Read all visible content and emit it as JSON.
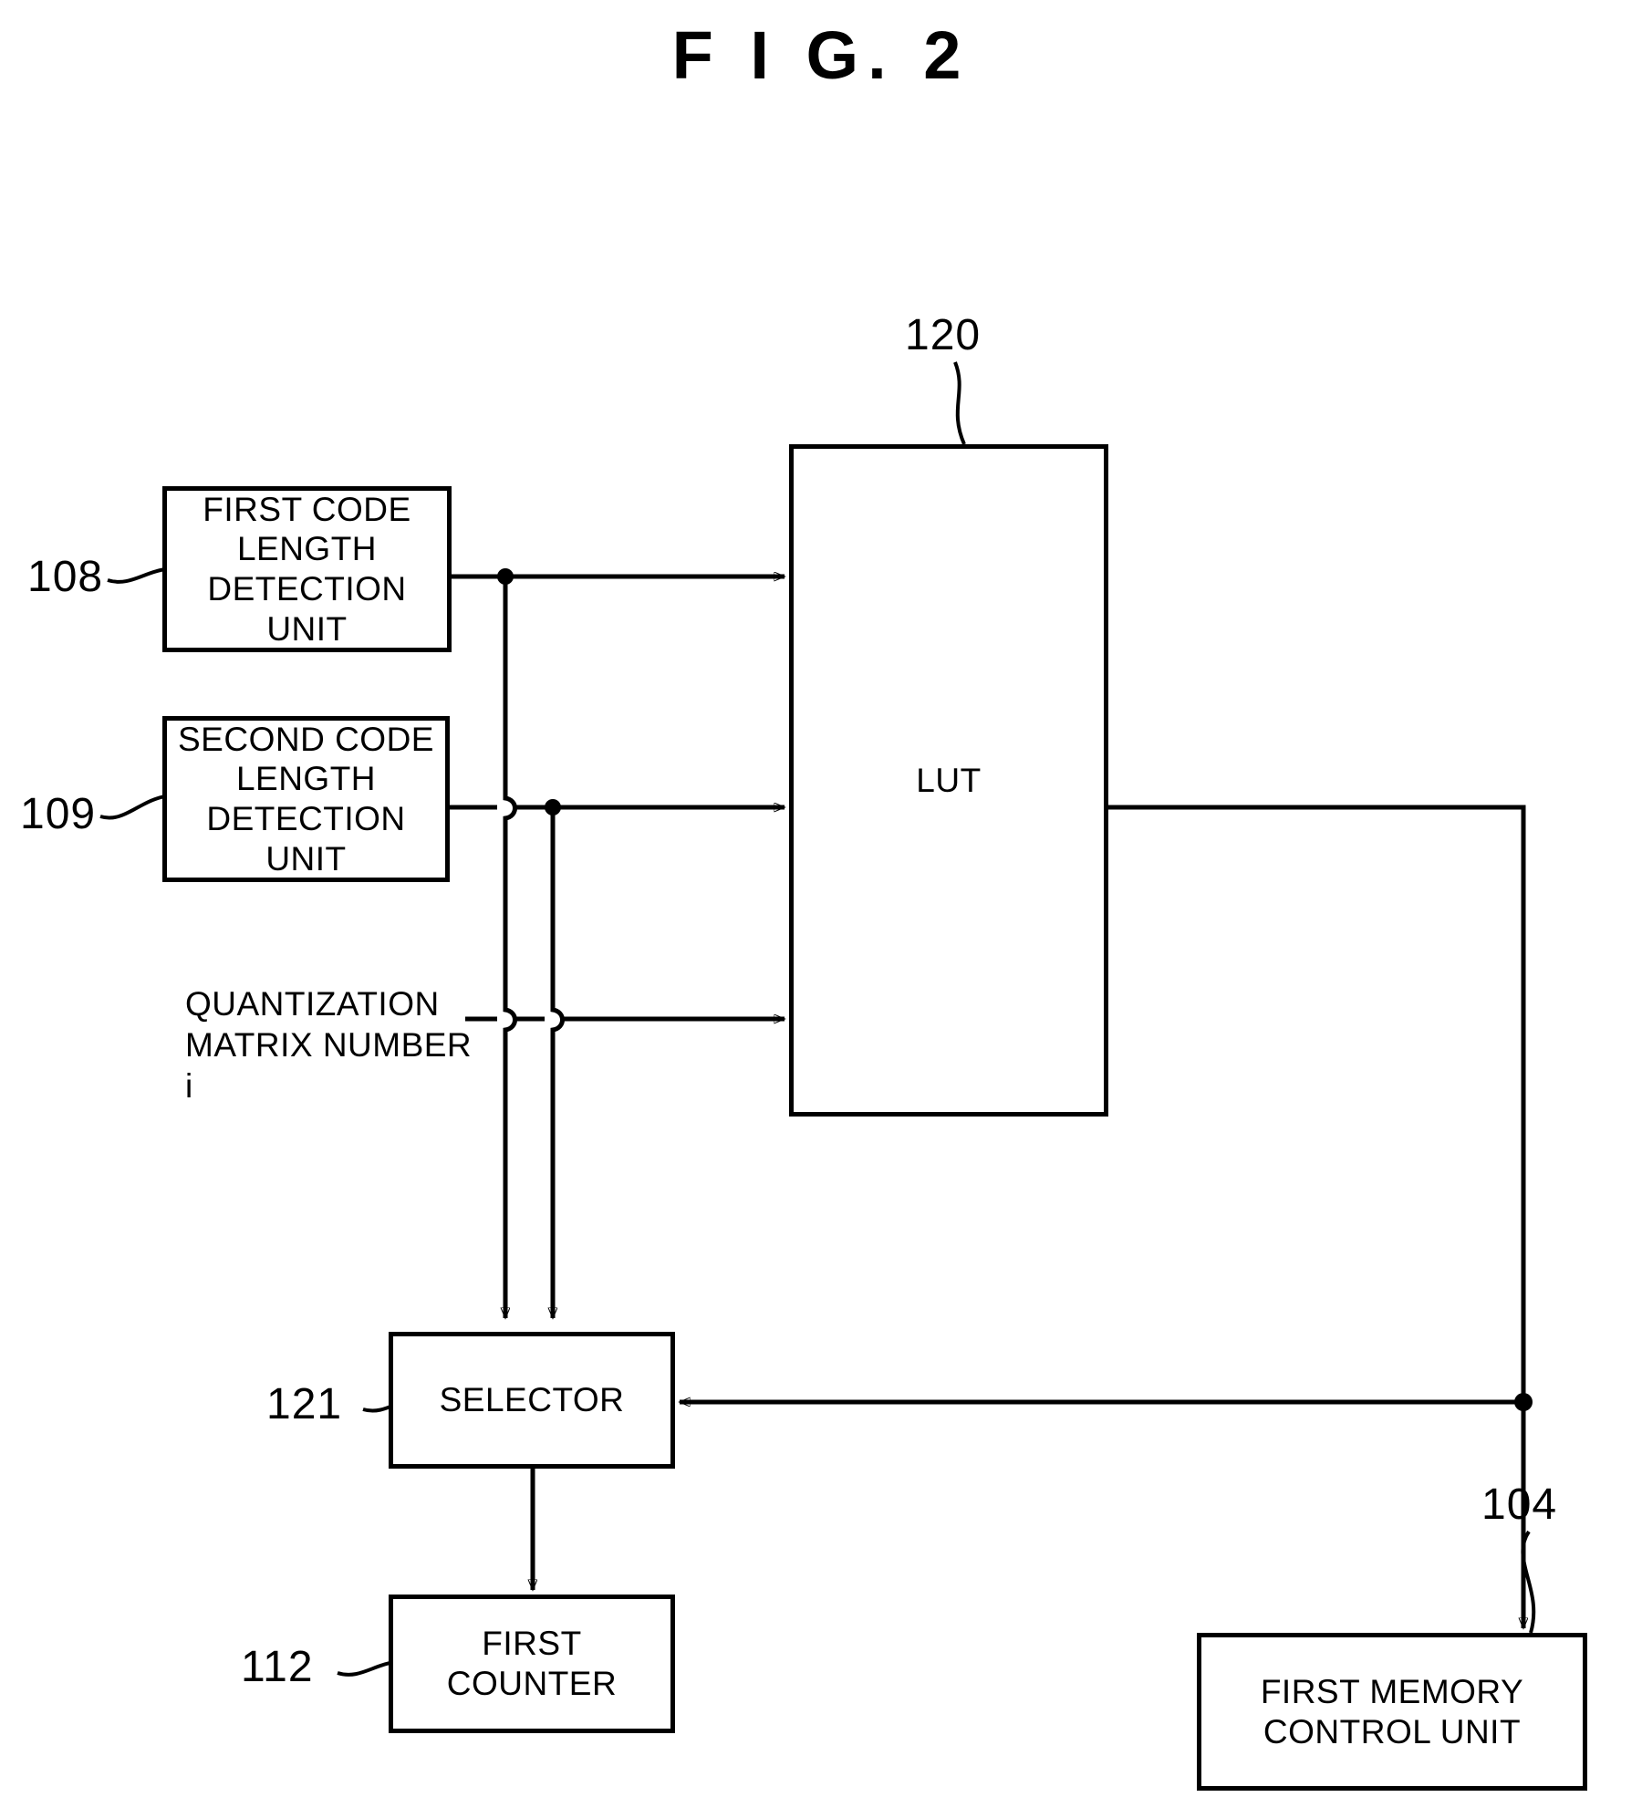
{
  "figure": {
    "title": "F I G.  2",
    "type": "patent-block-diagram"
  },
  "blocks": [
    {
      "id": "first-code-length-detection-unit",
      "ref": "108",
      "label": "FIRST CODE\nLENGTH\nDETECTION UNIT",
      "line1": "FIRST CODE",
      "line2": "LENGTH",
      "line3": "DETECTION UNIT"
    },
    {
      "id": "second-code-length-detection-unit",
      "ref": "109",
      "label": "SECOND CODE\nLENGTH\nDETECTION UNIT",
      "line1": "SECOND CODE",
      "line2": "LENGTH",
      "line3": "DETECTION UNIT"
    },
    {
      "id": "lut",
      "ref": "120",
      "label": "LUT"
    },
    {
      "id": "selector",
      "ref": "121",
      "label": "SELECTOR"
    },
    {
      "id": "first-counter",
      "ref": "112",
      "label": "FIRST COUNTER"
    },
    {
      "id": "first-memory-control-unit",
      "ref": "104",
      "label": "FIRST MEMORY\nCONTROL UNIT",
      "line1": "FIRST MEMORY",
      "line2": "CONTROL UNIT"
    }
  ],
  "signals": [
    {
      "id": "quantization-matrix-number",
      "line1": "QUANTIZATION",
      "line2": "MATRIX NUMBER i"
    }
  ],
  "reference_numerals": {
    "box_108": "108",
    "box_109": "109",
    "box_120": "120",
    "box_121": "121",
    "box_112": "112",
    "box_104": "104"
  },
  "colors": {
    "ink": "#000000",
    "paper": "#ffffff"
  }
}
